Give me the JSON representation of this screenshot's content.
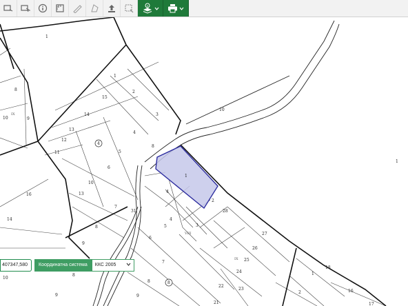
{
  "toolbar": {
    "buttons": [
      {
        "icon": "select-rectangle-icon"
      },
      {
        "icon": "select-arrow-icon"
      },
      {
        "icon": "info-icon"
      },
      {
        "icon": "measure-area-icon"
      },
      {
        "icon": "ruler-icon"
      },
      {
        "icon": "polygon-icon"
      },
      {
        "icon": "upload-icon"
      },
      {
        "icon": "zoom-box-icon"
      }
    ],
    "layers_button_icon": "layers-info-icon",
    "print_button_icon": "print-icon",
    "accent": "#1f7a3a"
  },
  "map": {
    "highlight_color": "#2d2d9f",
    "highlight_fill": "#c6c8ea",
    "parcel_labels": [
      "1",
      "1",
      "2",
      "15",
      "3",
      "14",
      "4",
      "13",
      "12",
      "11",
      "5",
      "6",
      "10",
      "7",
      "8",
      "9",
      "16",
      "14",
      "10",
      "8",
      "9",
      "10",
      "1",
      "4",
      "2",
      "28",
      "5",
      "3",
      "27",
      "6",
      "26",
      "25",
      "24",
      "7",
      "23",
      "22",
      "8",
      "21",
      "9",
      "1",
      "2",
      "16",
      "17",
      "8",
      "9",
      "10",
      "1",
      "31",
      "4",
      "8",
      "13",
      "18"
    ],
    "circled_labels": [
      "4",
      "8"
    ],
    "roman_labels": [
      "IX",
      "VIII",
      "IX"
    ]
  },
  "coordinates": {
    "value": "407347,580",
    "system_label": "Координатна система",
    "system_value": "ККС 2005"
  }
}
